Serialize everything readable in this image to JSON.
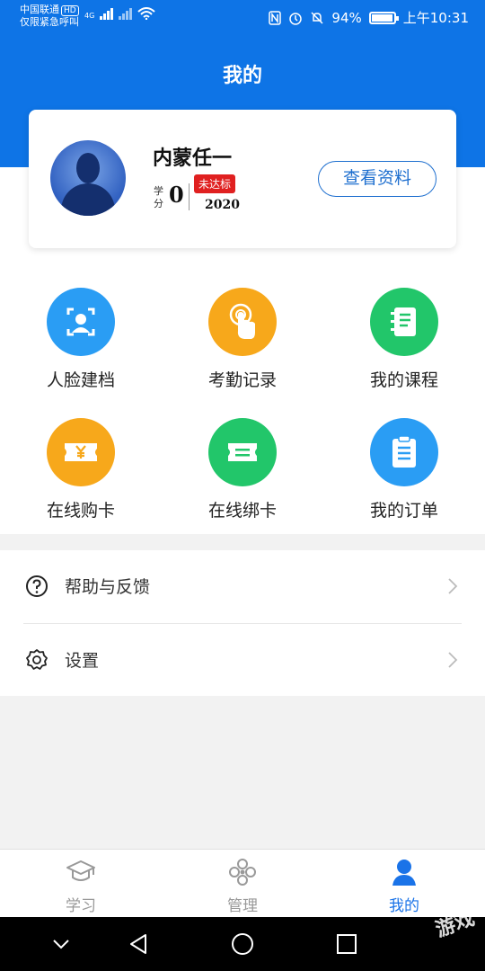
{
  "status_bar": {
    "carrier": "中国联通",
    "hd": "HD",
    "emergency": "仅限紧急呼叫",
    "network": "4G",
    "battery": "94%",
    "time": "上午10:31"
  },
  "header": {
    "title": "我的"
  },
  "profile": {
    "name": "内蒙任一",
    "score_label": "学分",
    "score": "0",
    "badge": "未达标",
    "year": "2020",
    "view_button": "查看资料"
  },
  "grid": [
    {
      "label": "人脸建档",
      "icon": "face-scan-icon",
      "color": "#2a9df4"
    },
    {
      "label": "考勤记录",
      "icon": "touch-icon",
      "color": "#f7a81b"
    },
    {
      "label": "我的课程",
      "icon": "notebook-icon",
      "color": "#22c66a"
    },
    {
      "label": "在线购卡",
      "icon": "yen-card-icon",
      "color": "#f7a81b"
    },
    {
      "label": "在线绑卡",
      "icon": "ticket-icon",
      "color": "#22c66a"
    },
    {
      "label": "我的订单",
      "icon": "clipboard-icon",
      "color": "#2a9df4"
    }
  ],
  "menu": [
    {
      "label": "帮助与反馈",
      "icon": "help-icon"
    },
    {
      "label": "设置",
      "icon": "settings-icon"
    }
  ],
  "tabs": [
    {
      "label": "学习",
      "icon": "graduation-cap-icon"
    },
    {
      "label": "管理",
      "icon": "manage-icon"
    },
    {
      "label": "我的",
      "icon": "user-icon",
      "active": true
    }
  ],
  "colors": {
    "primary": "#0e74e6",
    "accent": "#1a73e8",
    "badge": "#e02020"
  },
  "watermark": "游戏"
}
